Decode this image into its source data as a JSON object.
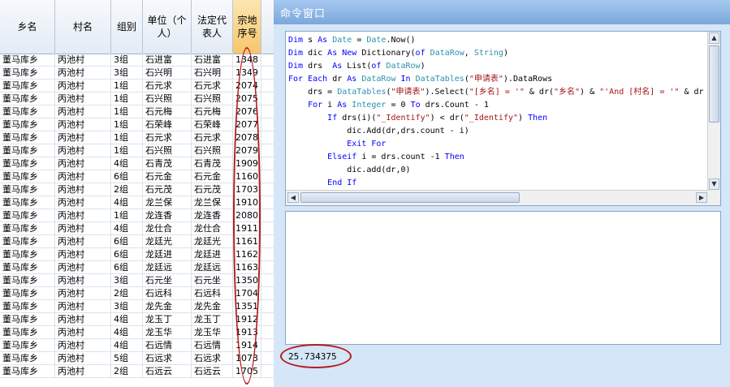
{
  "grid": {
    "columns": [
      "乡名",
      "村名",
      "组别",
      "单位（个人）",
      "法定代表人",
      "宗地序号"
    ],
    "rows": [
      [
        "董马库乡",
        "丙池村",
        "3组",
        "石进富",
        "石进富",
        "1348"
      ],
      [
        "董马库乡",
        "丙池村",
        "3组",
        "石兴明",
        "石兴明",
        "1349"
      ],
      [
        "董马库乡",
        "丙池村",
        "1组",
        "石元求",
        "石元求",
        "2074"
      ],
      [
        "董马库乡",
        "丙池村",
        "1组",
        "石兴照",
        "石兴照",
        "2075"
      ],
      [
        "董马库乡",
        "丙池村",
        "1组",
        "石元梅",
        "石元梅",
        "2076"
      ],
      [
        "董马库乡",
        "丙池村",
        "1组",
        "石荣峰",
        "石荣峰",
        "2077"
      ],
      [
        "董马库乡",
        "丙池村",
        "1组",
        "石元求",
        "石元求",
        "2078"
      ],
      [
        "董马库乡",
        "丙池村",
        "1组",
        "石兴照",
        "石兴照",
        "2079"
      ],
      [
        "董马库乡",
        "丙池村",
        "4组",
        "石青茂",
        "石青茂",
        "1909"
      ],
      [
        "董马库乡",
        "丙池村",
        "6组",
        "石元金",
        "石元金",
        "1160"
      ],
      [
        "董马库乡",
        "丙池村",
        "2组",
        "石元茂",
        "石元茂",
        "1703"
      ],
      [
        "董马库乡",
        "丙池村",
        "4组",
        "龙兰保",
        "龙兰保",
        "1910"
      ],
      [
        "董马库乡",
        "丙池村",
        "1组",
        "龙连香",
        "龙连香",
        "2080"
      ],
      [
        "董马库乡",
        "丙池村",
        "4组",
        "龙仕合",
        "龙仕合",
        "1911"
      ],
      [
        "董马库乡",
        "丙池村",
        "6组",
        "龙廷光",
        "龙廷光",
        "1161"
      ],
      [
        "董马库乡",
        "丙池村",
        "6组",
        "龙廷进",
        "龙廷进",
        "1162"
      ],
      [
        "董马库乡",
        "丙池村",
        "6组",
        "龙廷远",
        "龙廷远",
        "1163"
      ],
      [
        "董马库乡",
        "丙池村",
        "3组",
        "石元坐",
        "石元坐",
        "1350"
      ],
      [
        "董马库乡",
        "丙池村",
        "2组",
        "石远科",
        "石远科",
        "1704"
      ],
      [
        "董马库乡",
        "丙池村",
        "3组",
        "龙先金",
        "龙先金",
        "1351"
      ],
      [
        "董马库乡",
        "丙池村",
        "4组",
        "龙玉丁",
        "龙玉丁",
        "1912"
      ],
      [
        "董马库乡",
        "丙池村",
        "4组",
        "龙玉华",
        "龙玉华",
        "1913"
      ],
      [
        "董马库乡",
        "丙池村",
        "4组",
        "石远情",
        "石远情",
        "1914"
      ],
      [
        "董马库乡",
        "丙池村",
        "5组",
        "石远求",
        "石远求",
        "1073"
      ],
      [
        "董马库乡",
        "丙池村",
        "2组",
        "石远云",
        "石远云",
        "1705"
      ]
    ]
  },
  "command_window": {
    "title": "命令窗口",
    "code_lines": [
      [
        [
          "k",
          "Dim"
        ],
        [
          "p",
          " s "
        ],
        [
          "k",
          "As"
        ],
        [
          "p",
          " "
        ],
        [
          "t",
          "Date"
        ],
        [
          "p",
          " = "
        ],
        [
          "t",
          "Date"
        ],
        [
          "p",
          ".Now()"
        ]
      ],
      [
        [
          "k",
          "Dim"
        ],
        [
          "p",
          " dic "
        ],
        [
          "k",
          "As New"
        ],
        [
          "p",
          " Dictionary("
        ],
        [
          "k",
          "of"
        ],
        [
          "p",
          " "
        ],
        [
          "t",
          "DataRow"
        ],
        [
          "p",
          ", "
        ],
        [
          "t",
          "String"
        ],
        [
          "p",
          ")"
        ]
      ],
      [
        [
          "k",
          "Dim"
        ],
        [
          "p",
          " drs  "
        ],
        [
          "k",
          "As"
        ],
        [
          "p",
          " List("
        ],
        [
          "k",
          "of"
        ],
        [
          "p",
          " "
        ],
        [
          "t",
          "DataRow"
        ],
        [
          "p",
          ")"
        ]
      ],
      [
        [
          "k",
          "For Each"
        ],
        [
          "p",
          " dr "
        ],
        [
          "k",
          "As"
        ],
        [
          "p",
          " "
        ],
        [
          "t",
          "DataRow"
        ],
        [
          "p",
          " "
        ],
        [
          "k",
          "In"
        ],
        [
          "p",
          " "
        ],
        [
          "t",
          "DataTables"
        ],
        [
          "p",
          "("
        ],
        [
          "s",
          "\"申请表\""
        ],
        [
          "p",
          ").DataRows"
        ]
      ],
      [
        [
          "p",
          "    drs = "
        ],
        [
          "t",
          "DataTables"
        ],
        [
          "p",
          "("
        ],
        [
          "s",
          "\"申请表\""
        ],
        [
          "p",
          ").Select("
        ],
        [
          "s",
          "\"[乡名] = '\""
        ],
        [
          "p",
          " & dr("
        ],
        [
          "s",
          "\"乡名\""
        ],
        [
          "p",
          ") & "
        ],
        [
          "s",
          "\"'And [村名] = '\""
        ],
        [
          "p",
          " & dr"
        ]
      ],
      [
        [
          "p",
          "    "
        ],
        [
          "k",
          "For"
        ],
        [
          "p",
          " i "
        ],
        [
          "k",
          "As"
        ],
        [
          "p",
          " "
        ],
        [
          "t",
          "Integer"
        ],
        [
          "p",
          " = 0 "
        ],
        [
          "k",
          "To"
        ],
        [
          "p",
          " drs.Count - 1"
        ]
      ],
      [
        [
          "p",
          "        "
        ],
        [
          "k",
          "If"
        ],
        [
          "p",
          " drs(i)("
        ],
        [
          "s",
          "\"_Identify\""
        ],
        [
          "p",
          ") < dr("
        ],
        [
          "s",
          "\"_Identify\""
        ],
        [
          "p",
          ") "
        ],
        [
          "k",
          "Then"
        ]
      ],
      [
        [
          "p",
          "            dic.Add(dr,drs.count - i)"
        ]
      ],
      [
        [
          "p",
          "            "
        ],
        [
          "k",
          "Exit For"
        ]
      ],
      [
        [
          "p",
          "        "
        ],
        [
          "k",
          "Elseif"
        ],
        [
          "p",
          " i = drs.count -1 "
        ],
        [
          "k",
          "Then"
        ]
      ],
      [
        [
          "p",
          "            dic.add(dr,0)"
        ]
      ],
      [
        [
          "p",
          "        "
        ],
        [
          "k",
          "End If"
        ]
      ]
    ],
    "result": "25.734375"
  }
}
